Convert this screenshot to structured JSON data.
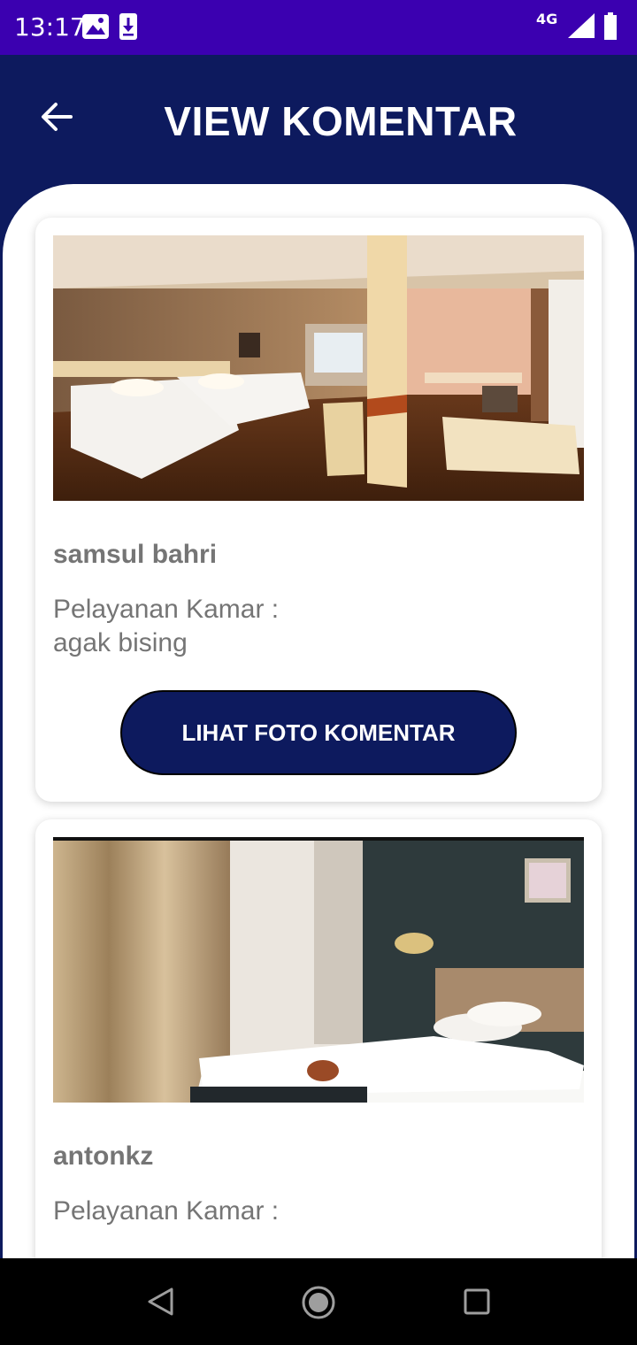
{
  "status_bar": {
    "time": "13:17",
    "network": "4G",
    "icons": [
      "image-icon",
      "download-icon",
      "signal-icon",
      "battery-icon"
    ]
  },
  "header": {
    "title": "VIEW KOMENTAR",
    "back_icon": "arrow-left-icon"
  },
  "comments": [
    {
      "user": "samsul bahri",
      "label": "Pelayanan Kamar :",
      "text": "agak bising",
      "button_label": "LIHAT FOTO KOMENTAR",
      "photo": "hotel-room-two-beds-photo"
    },
    {
      "user": "antonkz",
      "label": "Pelayanan Kamar :",
      "photo": "hotel-room-single-bed-photo"
    }
  ],
  "nav_bar": {
    "icons": [
      "nav-back-icon",
      "nav-home-icon",
      "nav-recent-icon"
    ]
  },
  "colors": {
    "status_bar": "#3b00b0",
    "primary": "#0d1a5e",
    "text_gray": "#757575",
    "card_bg": "#ffffff"
  }
}
